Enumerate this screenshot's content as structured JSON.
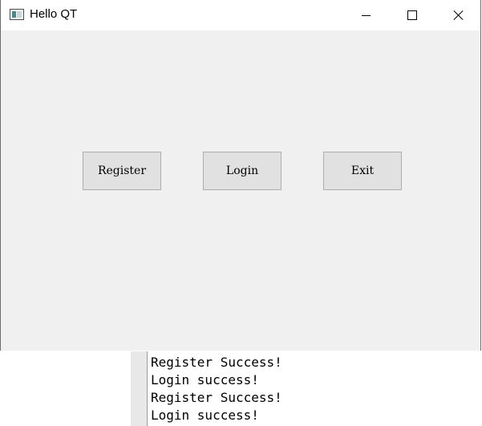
{
  "window": {
    "title": "Hello QT",
    "icon": "qt-app-window-icon",
    "controls": {
      "minimize_icon": "minimize-icon",
      "maximize_icon": "maximize-icon",
      "close_icon": "close-icon"
    }
  },
  "buttons": {
    "register_label": "Register",
    "login_label": "Login",
    "exit_label": "Exit"
  },
  "console": {
    "lines": [
      "Register Success!",
      "Login success!",
      "Register Success!",
      "Login success!"
    ]
  },
  "colors": {
    "window_background": "#f0f0f0",
    "titlebar_background": "#ffffff",
    "button_face": "#e1e1e1",
    "button_border": "#adadad"
  }
}
